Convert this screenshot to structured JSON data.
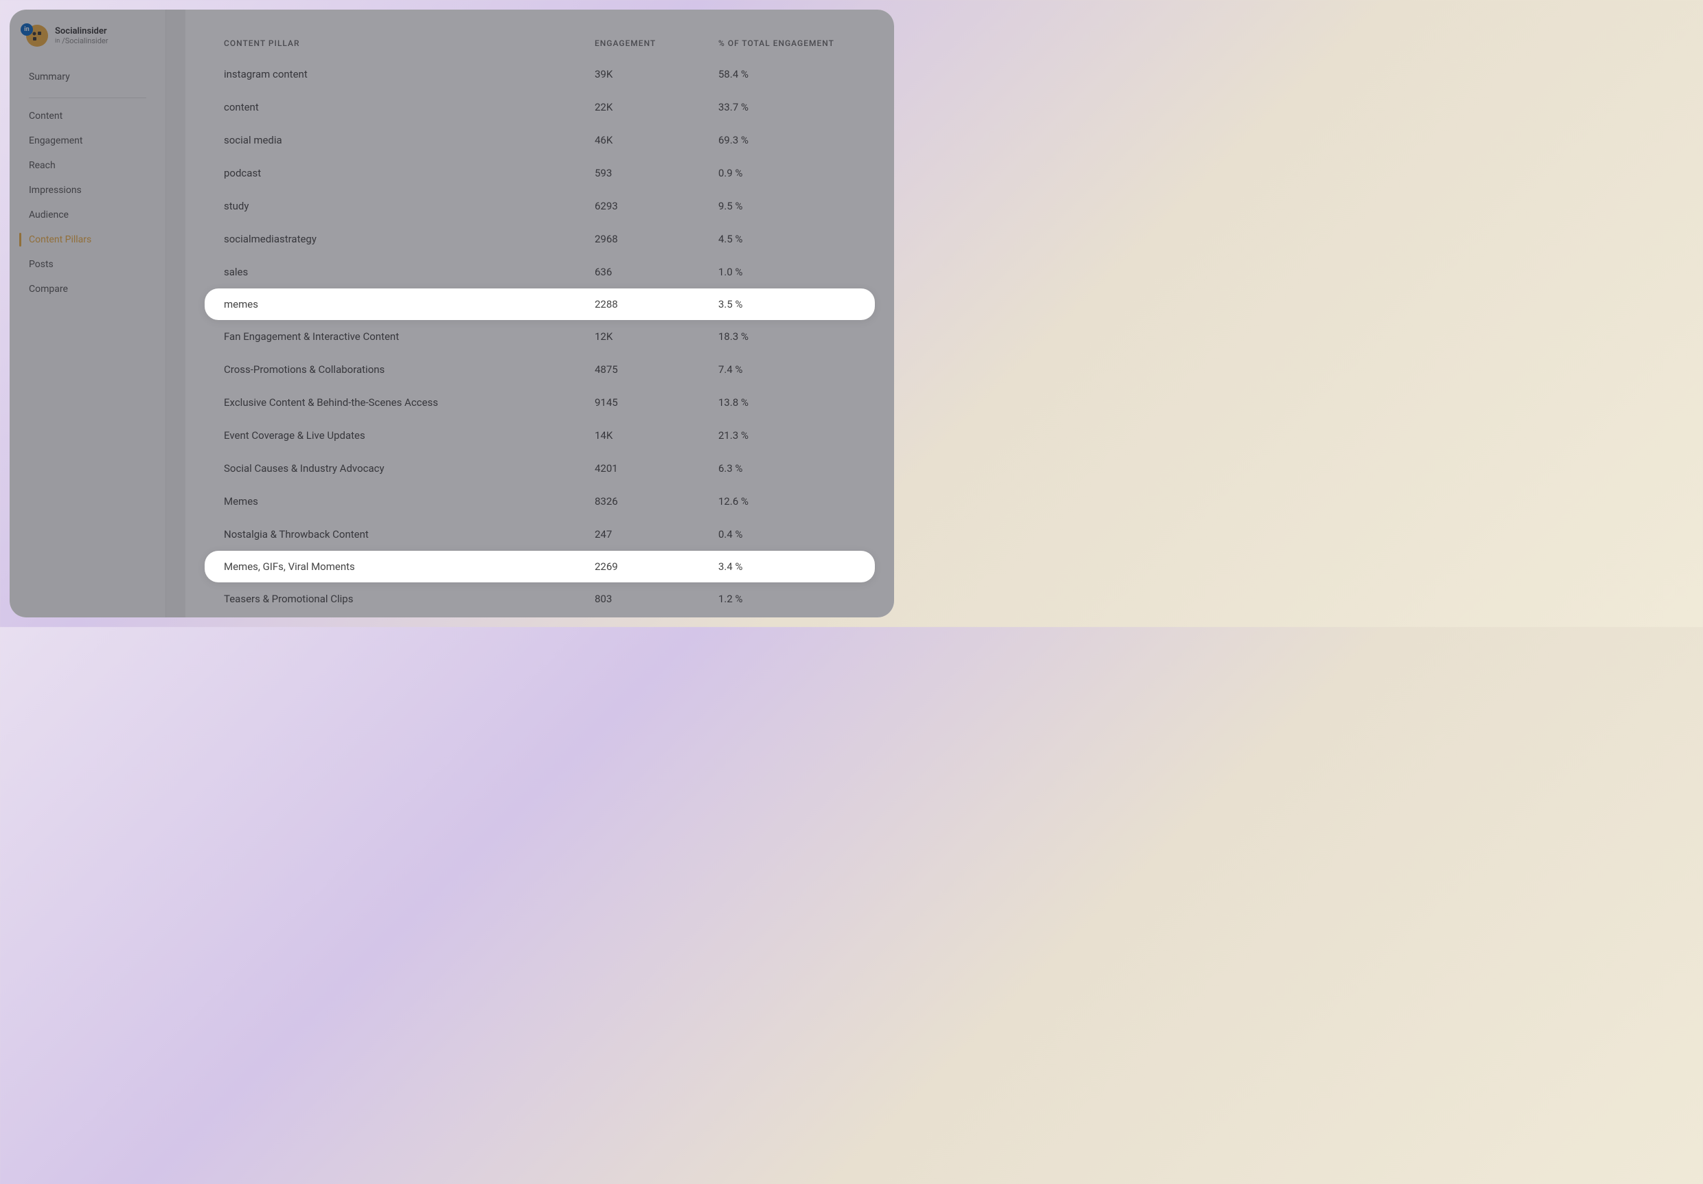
{
  "profile": {
    "name": "Socialinsider",
    "handle": "/Socialinsider",
    "platform_icon": "in"
  },
  "sidebar": {
    "summary": "Summary",
    "items": [
      {
        "label": "Content",
        "active": false
      },
      {
        "label": "Engagement",
        "active": false
      },
      {
        "label": "Reach",
        "active": false
      },
      {
        "label": "Impressions",
        "active": false
      },
      {
        "label": "Audience",
        "active": false
      },
      {
        "label": "Content Pillars",
        "active": true
      },
      {
        "label": "Posts",
        "active": false
      },
      {
        "label": "Compare",
        "active": false
      }
    ]
  },
  "table": {
    "headers": {
      "pillar": "CONTENT PILLAR",
      "engagement": "ENGAGEMENT",
      "percent": "% OF TOTAL ENGAGEMENT"
    },
    "rows": [
      {
        "pillar": "instagram content",
        "engagement": "39K",
        "percent": "58.4 %",
        "highlighted": false
      },
      {
        "pillar": "content",
        "engagement": "22K",
        "percent": "33.7 %",
        "highlighted": false
      },
      {
        "pillar": "social media",
        "engagement": "46K",
        "percent": "69.3 %",
        "highlighted": false
      },
      {
        "pillar": "podcast",
        "engagement": "593",
        "percent": "0.9 %",
        "highlighted": false
      },
      {
        "pillar": "study",
        "engagement": "6293",
        "percent": "9.5 %",
        "highlighted": false
      },
      {
        "pillar": "socialmediastrategy",
        "engagement": "2968",
        "percent": "4.5 %",
        "highlighted": false
      },
      {
        "pillar": "sales",
        "engagement": "636",
        "percent": "1.0 %",
        "highlighted": false
      },
      {
        "pillar": "memes",
        "engagement": "2288",
        "percent": "3.5 %",
        "highlighted": true
      },
      {
        "pillar": "Fan Engagement & Interactive Content",
        "engagement": "12K",
        "percent": "18.3 %",
        "highlighted": false
      },
      {
        "pillar": "Cross-Promotions & Collaborations",
        "engagement": "4875",
        "percent": "7.4 %",
        "highlighted": false
      },
      {
        "pillar": "Exclusive Content & Behind-the-Scenes Access",
        "engagement": "9145",
        "percent": "13.8 %",
        "highlighted": false
      },
      {
        "pillar": "Event Coverage & Live Updates",
        "engagement": "14K",
        "percent": "21.3 %",
        "highlighted": false
      },
      {
        "pillar": "Social Causes & Industry Advocacy",
        "engagement": "4201",
        "percent": "6.3 %",
        "highlighted": false
      },
      {
        "pillar": "Memes",
        "engagement": "8326",
        "percent": "12.6 %",
        "highlighted": false
      },
      {
        "pillar": "Nostalgia & Throwback Content",
        "engagement": "247",
        "percent": "0.4 %",
        "highlighted": false
      },
      {
        "pillar": "Memes, GIFs, Viral Moments",
        "engagement": "2269",
        "percent": "3.4 %",
        "highlighted": true
      },
      {
        "pillar": "Teasers & Promotional Clips",
        "engagement": "803",
        "percent": "1.2 %",
        "highlighted": false
      }
    ]
  }
}
